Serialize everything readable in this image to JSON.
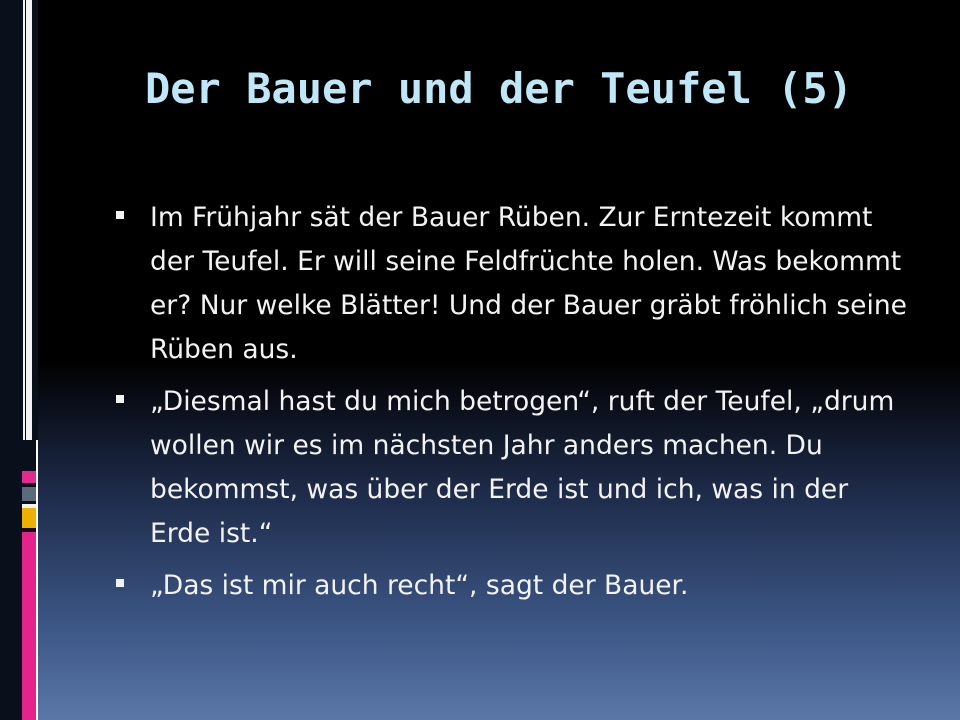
{
  "slide": {
    "title": "Der Bauer und der Teufel (5)",
    "bullets": [
      "Im Frühjahr sät der Bauer Rüben. Zur Erntezeit kommt der Teufel. Er will seine Feldfrüchte holen. Was bekommt er? Nur welke Blätter! Und der Bauer gräbt fröhlich seine Rüben aus.",
      "„Diesmal hast du mich betrogen“, ruft der Teufel, „drum wollen wir es im nächsten Jahr anders machen. Du bekommst, was über der Erde ist und ich, was in der Erde ist.“",
      "„Das ist mir auch recht“, sagt der Bauer."
    ]
  },
  "colors": {
    "title": "#bfe7f7",
    "text": "#f3f3f3",
    "accent_pink": "#e5238c",
    "accent_yellow": "#f0b000",
    "accent_gray": "#5b6b7c"
  },
  "icons": {
    "bullet": "square-bullet-icon"
  }
}
